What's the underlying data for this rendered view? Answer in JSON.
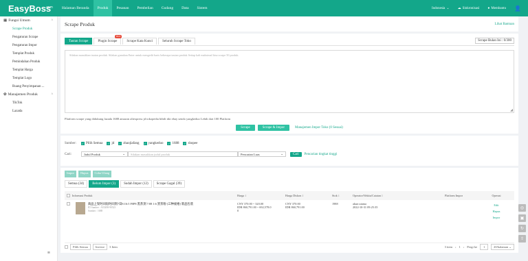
{
  "header": {
    "logo": "EasyBoss",
    "logo_suffix": ".com",
    "nav": [
      "Halaman Beranda",
      "Produk",
      "Pesanan",
      "Pembelian",
      "Gudang",
      "Data",
      "Sistem"
    ],
    "nav_active_index": 1,
    "language": "Indonesia",
    "sync": "Sinkronisasi",
    "help": "Membantu"
  },
  "sidebar": {
    "group1": "Fungsi Umum",
    "items1": [
      "Scrape Produk",
      "Pengaturan Scrape",
      "Pengaturan Impor",
      "Templat Produk",
      "Pemindahan Produk",
      "Templat Harga",
      "Templat Logo",
      "Ruang Penyimpanan ..."
    ],
    "active_index": 0,
    "group2": "Manajemen Produk",
    "items2": [
      "TikTok",
      "Lazada"
    ]
  },
  "page": {
    "title": "Scrape Produk",
    "help_link": "Lihat Bantuan"
  },
  "scrape": {
    "tabs": [
      "Tautan Scrape",
      "Plugin Scrape",
      "Scrape Kata Kunci",
      "Seluruh Scrape Toko"
    ],
    "plugin_badge": "HOT",
    "quota": "Scrape Bulan Ini : 0/300",
    "textarea_placeholder": "Silakan masukkan tautan produk. Silakan gunakan Enter untuk mengedit baris beberapa tautan produk Setiap kali maksimal bisa scrape 50 produk.",
    "platforms": "Platform scrape yang didukung lazada   1688   amazon   aliexpress   jd   tokopedia   bibili   tiki   ebay   sendo   yangkeduo Lebih dari 100 Platform",
    "btn_scrape": "Scrape",
    "btn_scrape_import": "Scrape & Impor",
    "manage_link": "Manajemen Impor Toko (0 Sesuai)"
  },
  "filter": {
    "source_label": "Sumber:",
    "sources": [
      "Pilih Semua",
      "jd",
      "zhaojiafang",
      "yangkeduo",
      "1688",
      "shopee"
    ],
    "search_label": "Cari:",
    "field_select": "Judul Produk",
    "search_placeholder": "Silakan masukkan judul produk",
    "mode_select": "Pencarian Luas",
    "search_btn": "Cari",
    "advanced_link": "Pencarian tingkat tinggi"
  },
  "list": {
    "bulk_buttons": [
      "Impor",
      "Hapus",
      "Coba Ulang"
    ],
    "subtabs": [
      "Semua (34)",
      "Belum Impor (3)",
      "Sudah Impor (12)",
      "Scrape Gagal (39)"
    ],
    "active_subtab": 1,
    "columns": [
      "Informasi Produk",
      "Harga ↕",
      "Harga Diskon ↕",
      "Stok ↕",
      "Operator/Waktu/Catatan ↕",
      "Platform Impor",
      "Operasi"
    ],
    "row": {
      "title": "商品上架时间短时间到7日8:16:5 F0P8 黑茶测 7:88 1:6 赏茶粉 [三种规格] 新品包装",
      "sku": "ID Sumber : A55498-90523",
      "source": "Sumber : 1688",
      "price": "CNY 370.00 ~ 320.00",
      "price_idr": "IDR 860,791.00 ~ 692,578.0",
      "price_tail": "0",
      "disc": "CNY 370.00",
      "disc_idr": "IDR 860,791.00",
      "stock": "1988",
      "operator": "akun utama",
      "time": "2022-10-31 09:25:35",
      "actions": [
        "Edit",
        "Hapus",
        "Impor"
      ]
    },
    "footer": {
      "select_all": "Pilih Semua",
      "inverse": "Inverse",
      "count": "3 Item",
      "total": "3 item",
      "page": "1",
      "goto": "Pergi ke",
      "page_input": "1",
      "per_page": "20/halaman"
    }
  }
}
